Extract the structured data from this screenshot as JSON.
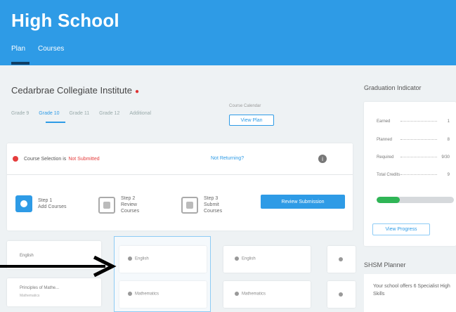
{
  "header": {
    "title": "High School",
    "tabs": [
      {
        "label": "Plan",
        "active": true
      },
      {
        "label": "Courses",
        "active": false
      }
    ]
  },
  "school": {
    "name": "Cedarbrae Collegiate Institute",
    "grade_tabs": [
      "Grade 9",
      "Grade 10",
      "Grade 11",
      "Grade 12",
      "Additional"
    ],
    "active_grade": "Grade 10",
    "calendar_label": "Course Calendar",
    "view_plan_label": "View Plan"
  },
  "selection": {
    "status_prefix": "Course Selection is",
    "status_value": "Not Submitted",
    "returning_link": "Not Returning?",
    "steps": [
      {
        "title": "Step 1",
        "line1": "Add Courses",
        "line2": ""
      },
      {
        "title": "Step 2",
        "line1": "Review",
        "line2": "Courses"
      },
      {
        "title": "Step 3",
        "line1": "Submit",
        "line2": "Courses"
      }
    ],
    "review_button": "Review Submission"
  },
  "courses": {
    "left_column": [
      {
        "title": "English",
        "sub": ""
      },
      {
        "title": "Principles of Mathe...",
        "sub": "Mathematics"
      }
    ],
    "col1": [
      "English",
      "Mathematics"
    ],
    "col2": [
      "English",
      "Mathematics"
    ]
  },
  "graduation": {
    "title": "Graduation Indicator",
    "rows": [
      {
        "label": "Earned",
        "value": "1"
      },
      {
        "label": "Planned",
        "value": "8"
      },
      {
        "label": "Required",
        "value": "9/30"
      },
      {
        "label": "Total Credits",
        "value": "9"
      }
    ],
    "progress_fraction": 0.3,
    "view_progress_label": "View Progress"
  },
  "shsm": {
    "title": "SHSM Planner",
    "text": "Your school offers 6 Specialist High Skills"
  },
  "colors": {
    "brand_blue": "#2e9be6",
    "status_red": "#e53d3d",
    "progress_green": "#2fb556"
  }
}
